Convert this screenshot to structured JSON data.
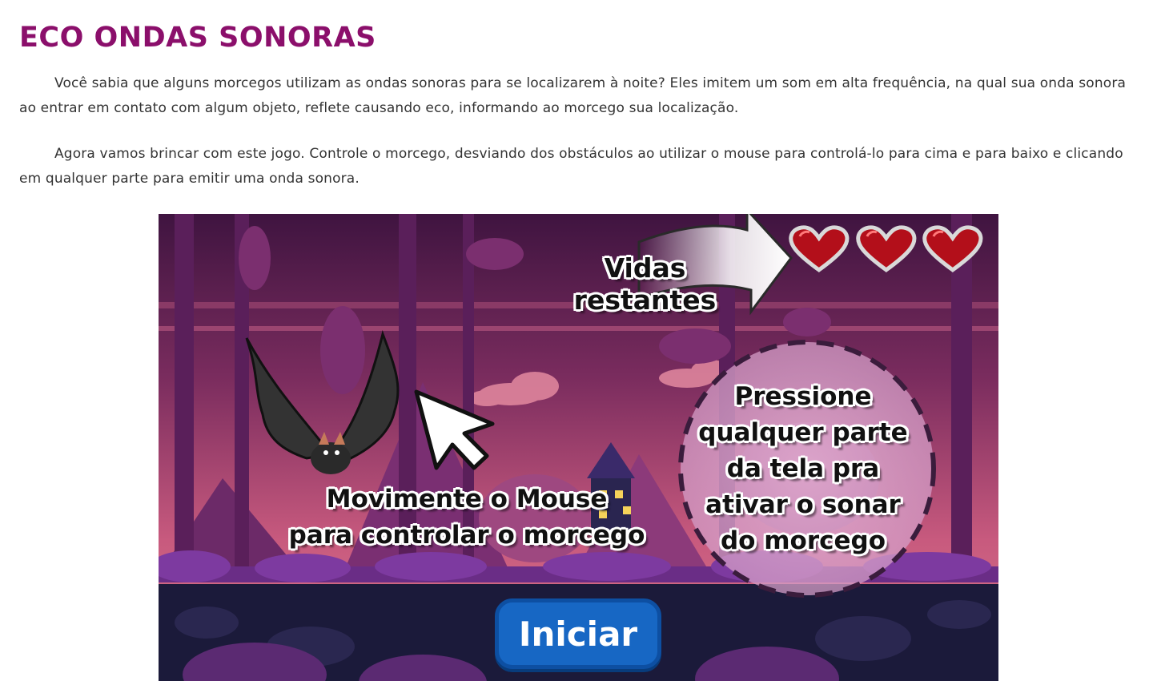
{
  "colors": {
    "title": "#8b0f6b",
    "sky_top": "#4a1848",
    "sky_bottom": "#d16b86",
    "ground_dark": "#1b1a3a",
    "start_button": "#1767c4",
    "heart": "#b30f1a"
  },
  "article": {
    "title": "ECO ONDAS SONORAS",
    "paragraphs": [
      "Você sabia que alguns morcegos utilizam as ondas sonoras para se localizarem à noite? Eles imitem um som em alta frequência, na qual sua onda sonora ao entrar em contato com algum objeto, reflete causando eco, informando ao morcego sua localização.",
      "Agora vamos brincar com este jogo. Controle o morcego, desviando dos obstáculos ao utilizar o mouse para controlá-lo para cima e para baixo e clicando em qualquer parte para emitir uma onda sonora."
    ]
  },
  "game": {
    "lives_label": "Vidas restantes",
    "lives_count": 3,
    "mouse_hint": "Movimente o Mouse\npara controlar o morcego",
    "sonar_hint": "Pressione\nqualquer parte\nda tela pra\nativar o sonar\ndo morcego",
    "start_button": "Iniciar",
    "icons": [
      "heart-icon",
      "arrow-right-icon",
      "mouse-cursor-icon",
      "bat-icon",
      "haunted-house-icon"
    ]
  }
}
